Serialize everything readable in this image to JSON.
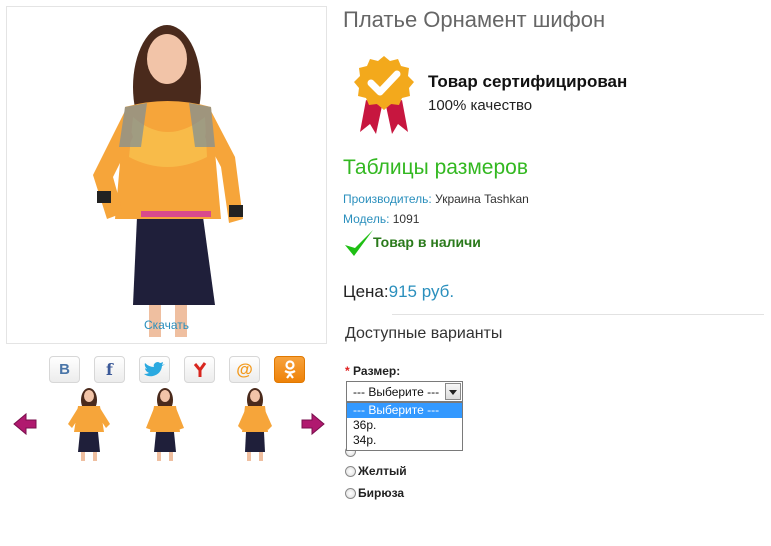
{
  "product": {
    "title": "Платье Орнамент шифон",
    "download_label": "Скачать"
  },
  "share": [
    {
      "name": "vk",
      "label": "В"
    },
    {
      "name": "facebook",
      "label": "f"
    },
    {
      "name": "twitter",
      "label": ""
    },
    {
      "name": "yaru",
      "label": ""
    },
    {
      "name": "mail",
      "label": "@"
    },
    {
      "name": "odnoklassniki",
      "label": ""
    }
  ],
  "certificate": {
    "title": "Товар сертифицирован",
    "subtitle": "100% качество"
  },
  "size_table_link": "Таблицы размеров",
  "meta": {
    "manufacturer_label": "Производитель:",
    "manufacturer_value": "Украина Tashkan",
    "model_label": "Модель:",
    "model_value": "1091"
  },
  "stock_status": "Товар в наличи",
  "price": {
    "label": "Цена:",
    "value": "915 руб."
  },
  "variants": {
    "title": "Доступные варианты",
    "size_required_mark": "*",
    "size_label": "Размер:",
    "selected": "--- Выберите ---",
    "options": [
      "--- Выберите ---",
      "36р.",
      "34р."
    ],
    "colors": [
      "Желтый",
      "Бирюза"
    ]
  },
  "colors": {
    "accent_green": "#33b821",
    "link_blue": "#2a8fbd",
    "select_highlight": "#3399ff",
    "required_red": "#e02020"
  }
}
